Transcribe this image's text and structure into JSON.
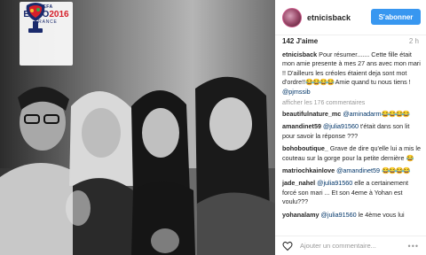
{
  "logo": {
    "uefa": "UEFA",
    "euro": "EURO",
    "year": "2016",
    "country": "FRANCE"
  },
  "post": {
    "username": "etnicisback",
    "follow_label": "S'abonner",
    "likes": "142 J'aime",
    "time": "2 h",
    "caption_user": "etnicisback",
    "caption_text": "Pour résumer....... Cette fille était mon amie presente à mes 27 ans avec mon mari !! D'ailleurs les créoles étaient deja sont mot d'ordre!!",
    "caption_emoji": "😂😂😂😂",
    "caption_tail": " Amie quand tu nous tiens ! ",
    "caption_mention": "@pjmssib",
    "more_comments": "afficher les 176 commentaires"
  },
  "comments": [
    {
      "user": "beautifulnature_mc",
      "mention": "@aminadarm",
      "text": "",
      "emoji": "😂😂😂😂"
    },
    {
      "user": "amandinet59",
      "mention": "@julia91560",
      "text": " t'était dans son lit pour savoir la réponse ???",
      "emoji": ""
    },
    {
      "user": "bohoboutique_",
      "mention": "",
      "text": "Grave de dire qu'elle lui a mis le couteau sur la gorge pour la petite dernière ",
      "emoji": "😂"
    },
    {
      "user": "matriochkainlove",
      "mention": "@amandinet59",
      "text": " ",
      "emoji": "😂😂😂😂"
    },
    {
      "user": "jade_nahel",
      "mention": "@julia91560",
      "text": " elle a certainement forcé son mari ... Et son 4eme à Yohan est voulu???",
      "emoji": ""
    },
    {
      "user": "yohanalamy",
      "mention": "@julia91560",
      "text": " le 4ème vous lui",
      "emoji": ""
    }
  ],
  "footer": {
    "add_comment_placeholder": "Ajouter un commentaire...",
    "more": "•••"
  },
  "colors": {
    "follow": "#3897f0",
    "mention": "#003569"
  }
}
